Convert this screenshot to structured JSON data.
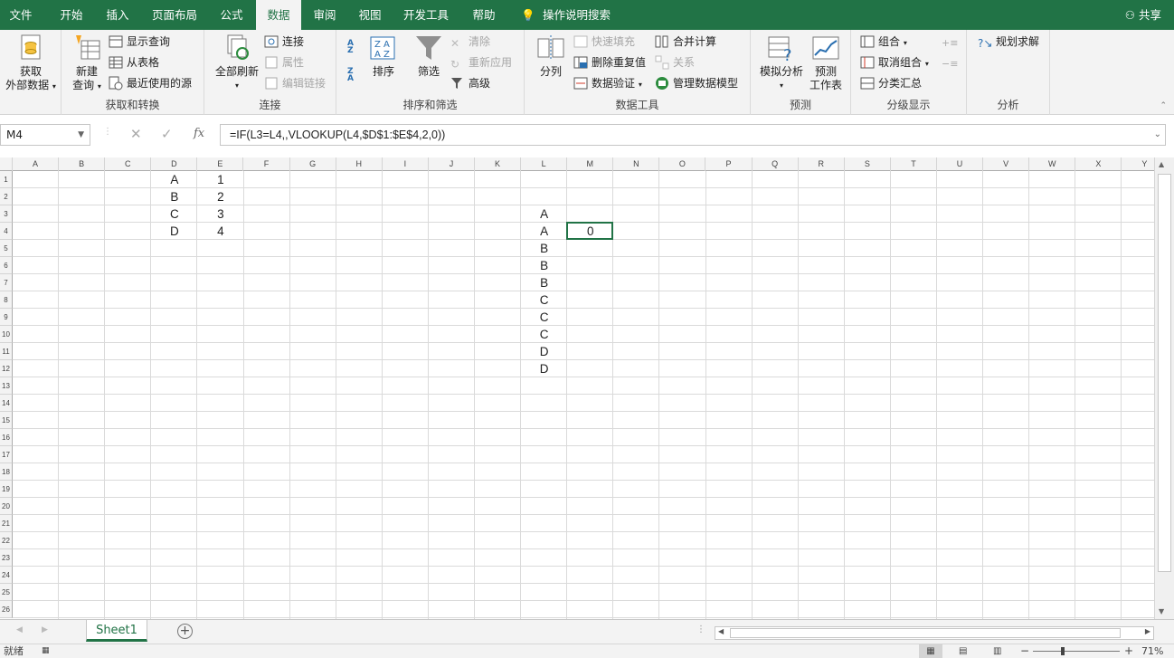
{
  "tabs": [
    "文件",
    "开始",
    "插入",
    "页面布局",
    "公式",
    "数据",
    "审阅",
    "视图",
    "开发工具",
    "帮助"
  ],
  "active_tab": "数据",
  "tell_me": "操作说明搜索",
  "share": "共享",
  "ribbon": {
    "get_external_line1": "获取",
    "get_external_line2": "外部数据",
    "new_query_line1": "新建",
    "new_query_line2": "查询",
    "show_queries": "显示查询",
    "from_table": "从表格",
    "recent_sources": "最近使用的源",
    "group_get_transform": "获取和转换",
    "refresh_all": "全部刷新",
    "connections": "连接",
    "properties": "属性",
    "edit_links": "编辑链接",
    "group_connections": "连接",
    "sort": "排序",
    "filter": "筛选",
    "clear": "清除",
    "reapply": "重新应用",
    "advanced": "高级",
    "group_sort_filter": "排序和筛选",
    "text_to_columns": "分列",
    "flash_fill": "快速填充",
    "remove_duplicates": "删除重复值",
    "data_validation": "数据验证",
    "consolidate": "合并计算",
    "relationships": "关系",
    "manage_data_model": "管理数据模型",
    "group_data_tools": "数据工具",
    "what_if": "模拟分析",
    "forecast_line1": "预测",
    "forecast_line2": "工作表",
    "group_forecast": "预测",
    "group_btn": "组合",
    "ungroup": "取消组合",
    "subtotal": "分类汇总",
    "group_outline": "分级显示",
    "solver": "规划求解",
    "group_analysis": "分析"
  },
  "formula_bar": {
    "name_box": "M4",
    "fx": "fx",
    "formula": "=IF(L3=L4,,VLOOKUP(L4,$D$1:$E$4,2,0))"
  },
  "columns": [
    "A",
    "B",
    "C",
    "D",
    "E",
    "F",
    "G",
    "H",
    "I",
    "J",
    "K",
    "L",
    "M",
    "N",
    "O",
    "P",
    "Q",
    "R",
    "S",
    "T",
    "U",
    "V",
    "W",
    "X",
    "Y"
  ],
  "rows": [
    "1",
    "2",
    "3",
    "4",
    "5",
    "6",
    "7",
    "8",
    "9",
    "10",
    "11",
    "12",
    "13",
    "14",
    "15",
    "16",
    "17",
    "18",
    "19",
    "20",
    "21",
    "22",
    "23",
    "24",
    "25",
    "26"
  ],
  "cells": [
    {
      "ref": "D1",
      "value": "A"
    },
    {
      "ref": "E1",
      "value": "1"
    },
    {
      "ref": "D2",
      "value": "B"
    },
    {
      "ref": "E2",
      "value": "2"
    },
    {
      "ref": "D3",
      "value": "C"
    },
    {
      "ref": "E3",
      "value": "3"
    },
    {
      "ref": "D4",
      "value": "D"
    },
    {
      "ref": "E4",
      "value": "4"
    },
    {
      "ref": "L3",
      "value": "A"
    },
    {
      "ref": "L4",
      "value": "A"
    },
    {
      "ref": "M4",
      "value": "0"
    },
    {
      "ref": "L5",
      "value": "B"
    },
    {
      "ref": "L6",
      "value": "B"
    },
    {
      "ref": "L7",
      "value": "B"
    },
    {
      "ref": "L8",
      "value": "C"
    },
    {
      "ref": "L9",
      "value": "C"
    },
    {
      "ref": "L10",
      "value": "C"
    },
    {
      "ref": "L11",
      "value": "D"
    },
    {
      "ref": "L12",
      "value": "D"
    }
  ],
  "sheets": [
    "Sheet1"
  ],
  "status": {
    "ready": "就绪",
    "zoom": "71%"
  },
  "colors": {
    "accent": "#217346",
    "grid": "#dadada"
  }
}
